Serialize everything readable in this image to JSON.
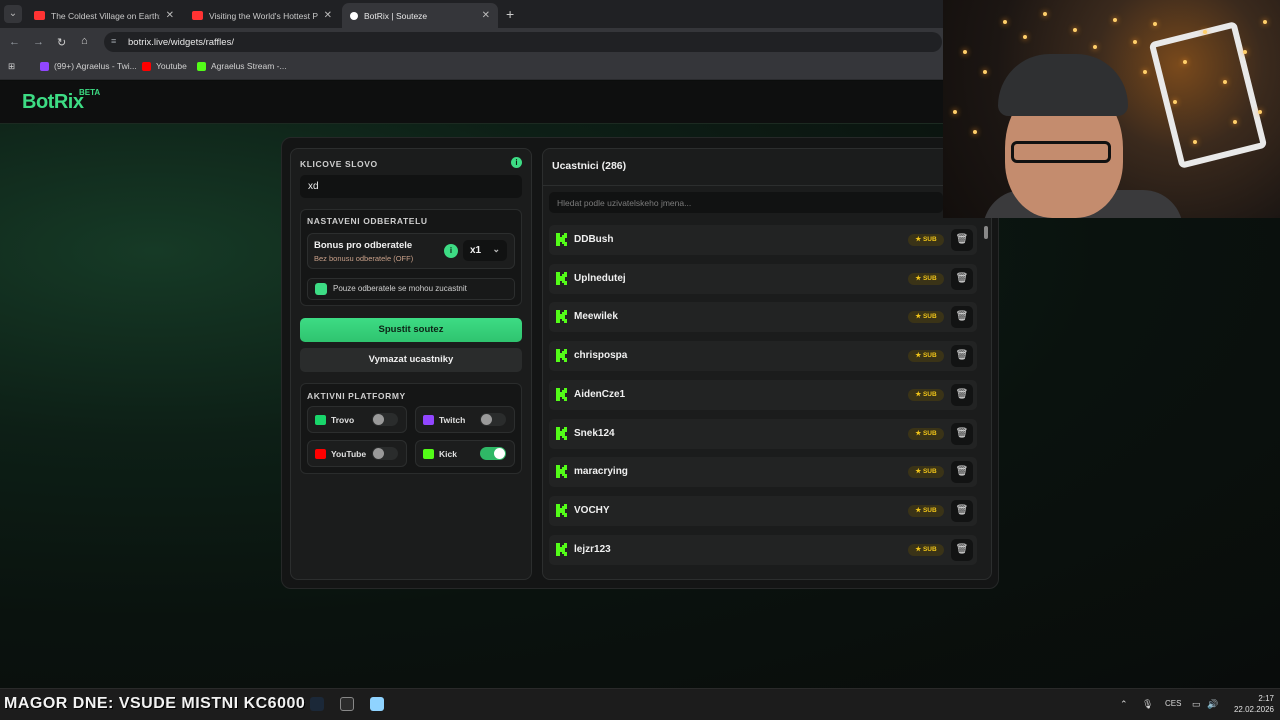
{
  "browser": {
    "tabs": [
      {
        "title": "The Coldest Village on Earth: O",
        "favicon_color": "#ff3333"
      },
      {
        "title": "Visiting the World's Hottest Pla",
        "favicon_color": "#ff3333"
      },
      {
        "title": "BotRix | Souteze",
        "favicon_color": "#ffffff"
      }
    ],
    "url": "botrix.live/widgets/raffles/",
    "bookmarks": [
      {
        "label": "(99+) Agraelus - Twi...",
        "color": "#9146ff"
      },
      {
        "label": "Youtube",
        "color": "#ff0000"
      },
      {
        "label": "Agraelus Stream -...",
        "color": "#53fc18"
      }
    ]
  },
  "app": {
    "logo": "BotRix",
    "logo_badge": "BETA",
    "accent": "#3ddc84"
  },
  "settings": {
    "keyword_title": "KLICOVE SLOVO",
    "keyword_value": "xd",
    "subscriber_title": "NASTAVENI ODBERATELU",
    "bonus_title": "Bonus pro odberatele",
    "bonus_subtitle": "Bez bonusu odberatele (OFF)",
    "multiplier": "x1",
    "sub_only_label": "Pouze odberatele se mohou zucastnit",
    "start_button": "Spustit soutez",
    "clear_button": "Vymazat ucastniky",
    "platforms_title": "AKTIVNI PLATFORMY",
    "platforms": [
      {
        "name": "Trovo",
        "enabled": false,
        "icon": "trovo-icon",
        "color": "#19d66b"
      },
      {
        "name": "Twitch",
        "enabled": false,
        "icon": "twitch-icon",
        "color": "#9146ff"
      },
      {
        "name": "YouTube",
        "enabled": false,
        "icon": "youtube-icon",
        "color": "#ff0000"
      },
      {
        "name": "Kick",
        "enabled": true,
        "icon": "kick-icon",
        "color": "#53fc18"
      }
    ]
  },
  "participants": {
    "title": "Ucastnici (286)",
    "search_placeholder": "Hledat podle uzivatelskeho jmena...",
    "badge_label": "SUB",
    "list": [
      {
        "name": "DDBush"
      },
      {
        "name": "Uplnedutej"
      },
      {
        "name": "Meewilek"
      },
      {
        "name": "chrispospa"
      },
      {
        "name": "AidenCze1"
      },
      {
        "name": "Snek124"
      },
      {
        "name": "maracrying"
      },
      {
        "name": "VOCHY"
      },
      {
        "name": "lejzr123"
      }
    ]
  },
  "taskbar": {
    "ticker": "MAGOR DNE: VSUDE   MISTNI KC6000",
    "language": "CES",
    "time": "2:17",
    "date": "22.02.2026"
  }
}
